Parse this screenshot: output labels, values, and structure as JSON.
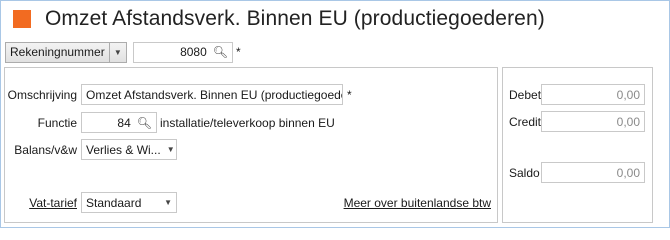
{
  "header": {
    "title": "Omzet Afstandsverk. Binnen EU (productiegoederen)",
    "accent_color": "#f26b21"
  },
  "account": {
    "dropdown_label": "Rekeningnummer",
    "number": "8080",
    "required_mark": "*"
  },
  "form": {
    "omschrijving_label": "Omschrijving",
    "omschrijving_value": "Omzet Afstandsverk. Binnen EU (productiegoedere",
    "omschrijving_required": "*",
    "functie_label": "Functie",
    "functie_value": "84",
    "functie_description": "installatie/televerkoop binnen EU",
    "balans_label": "Balans/v&w",
    "balans_value": "Verlies & Wi...",
    "vat_label": "Vat-tarief",
    "vat_value": "Standaard",
    "more_link": "Meer over buitenlandse btw"
  },
  "totals": {
    "debet_label": "Debet",
    "debet_value": "0,00",
    "credit_label": "Credit",
    "credit_value": "0,00",
    "saldo_label": "Saldo",
    "saldo_value": "0,00"
  },
  "icons": {
    "search": "magnifier-icon",
    "dropdown": "chevron-down-icon"
  }
}
